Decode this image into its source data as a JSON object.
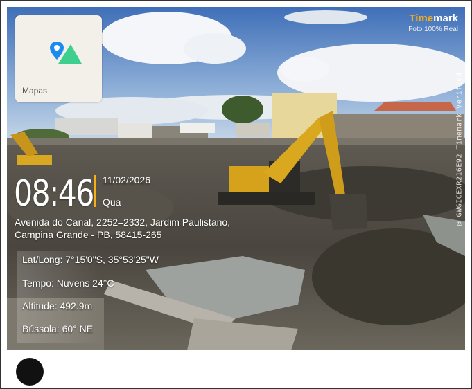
{
  "brand": {
    "name_accent": "Time",
    "name_rest": "mark",
    "subtitle": "Foto 100% Real"
  },
  "map_card": {
    "label": " Mapas",
    "apple_glyph": ""
  },
  "verification_code": "@ GWGICEXR216E92  Timemark Verified",
  "time": "08:46",
  "date": "11/02/2026",
  "weekday": "Qua",
  "address": {
    "line1": "Avenida do Canal, 2252–2332, Jardim Paulistano,",
    "line2": "Campina Grande - PB, 58415-265"
  },
  "details": {
    "latlong": "Lat/Long: 7°15'0\"S, 35°53'25\"W",
    "weather": "Tempo: Nuvens 24°C",
    "altitude": "Altitude: 492.9m",
    "compass": "Bússola: 60° NE"
  },
  "colors": {
    "accent": "#f7b014",
    "map_pin": "#1a8cf0",
    "map_mountain": "#3ecf8e"
  },
  "icons": {
    "map_pin": "map-pin-icon",
    "mountain": "mountain-icon"
  }
}
